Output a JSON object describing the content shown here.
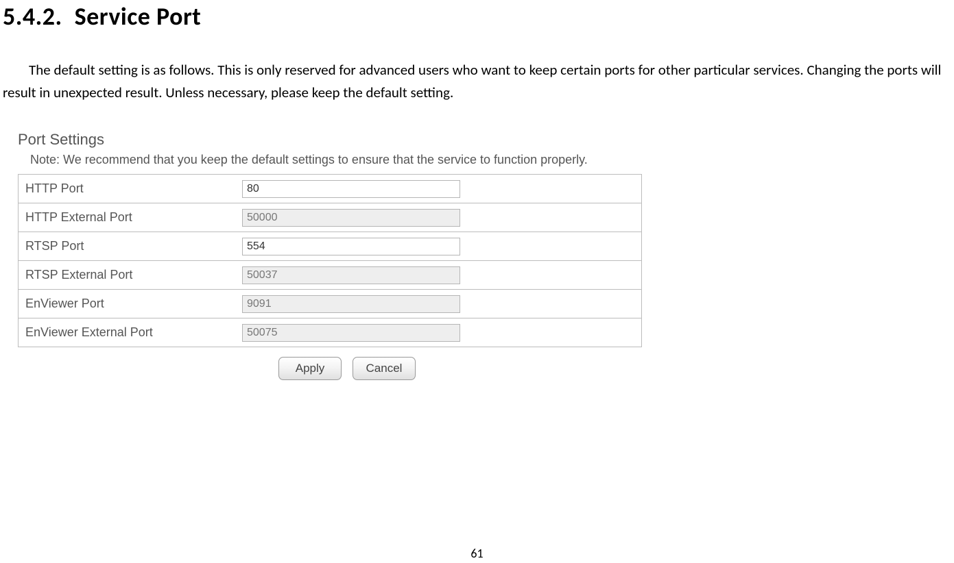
{
  "heading": {
    "number": "5.4.2.",
    "title": "Service Port"
  },
  "intro": "The default setting is as follows. This is only reserved for advanced users who want to keep certain ports for other particular services. Changing the ports will result in unexpected result. Unless necessary, please keep the default setting.",
  "panel": {
    "title": "Port Settings",
    "note": "Note: We recommend that you keep the default settings to ensure that the service to function properly.",
    "rows": [
      {
        "label": "HTTP Port",
        "value": "80",
        "disabled": false
      },
      {
        "label": "HTTP External Port",
        "value": "50000",
        "disabled": true
      },
      {
        "label": "RTSP Port",
        "value": "554",
        "disabled": false
      },
      {
        "label": "RTSP External Port",
        "value": "50037",
        "disabled": true
      },
      {
        "label": "EnViewer Port",
        "value": "9091",
        "disabled": true
      },
      {
        "label": "EnViewer External Port",
        "value": "50075",
        "disabled": true
      }
    ],
    "buttons": {
      "apply": "Apply",
      "cancel": "Cancel"
    }
  },
  "page_number": "61"
}
